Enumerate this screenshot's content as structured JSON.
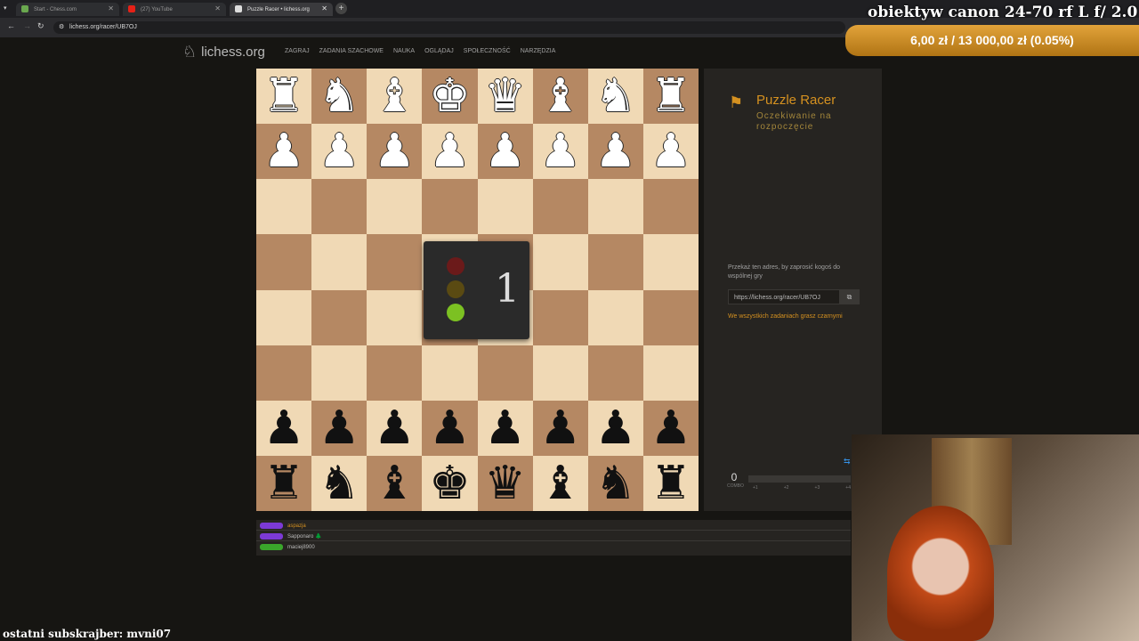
{
  "browser": {
    "tabs": [
      {
        "label": "Start - Chess.com",
        "color": "#6aa84f"
      },
      {
        "label": "(27) YouTube",
        "color": "#e62117"
      },
      {
        "label": "Puzzle Racer • lichess.org",
        "color": "#ffffff"
      }
    ],
    "url": "lichess.org/racer/UB7OJ"
  },
  "overlay": {
    "title": "obiektyw canon 24-70 rf L f/ 2.0",
    "goal": "6,00 zł / 13 000,00 zł (0.05%)",
    "goal_progress": 0.05,
    "last_sub": "ostatni subskrajber: mvni07"
  },
  "site": {
    "logo": "lichess.org",
    "nav": [
      "ZAGRAJ",
      "ZADANIA SZACHOWE",
      "NAUKA",
      "OGLĄDAJ",
      "SPOŁECZNOŚĆ",
      "NARZĘDZIA"
    ]
  },
  "board": {
    "rows": [
      [
        "♜",
        "♞",
        "♝",
        "♚",
        "♛",
        "♝",
        "♞",
        "♜"
      ],
      [
        "♟",
        "♟",
        "♟",
        "♟",
        "♟",
        "♟",
        "♟",
        "♟"
      ],
      [
        "",
        "",
        "",
        "",
        "",
        "",
        "",
        ""
      ],
      [
        "",
        "",
        "",
        "",
        "",
        "",
        "",
        ""
      ],
      [
        "",
        "",
        "",
        "",
        "",
        "",
        "",
        ""
      ],
      [
        "",
        "",
        "",
        "",
        "",
        "",
        "",
        ""
      ],
      [
        "♟",
        "♟",
        "♟",
        "♟",
        "♟",
        "♟",
        "♟",
        "♟"
      ],
      [
        "♜",
        "♞",
        "♝",
        "♚",
        "♛",
        "♝",
        "♞",
        "♜"
      ]
    ],
    "row_colors": [
      "w",
      "w",
      "",
      "",
      "",
      "",
      "b",
      "b"
    ]
  },
  "countdown": {
    "number": "1",
    "lights": [
      "#6b1a1a",
      "#5a4a12",
      "#7cc122"
    ]
  },
  "side": {
    "title": "Puzzle Racer",
    "status": "Oczekiwanie na rozpoczęcie",
    "invite_text": "Przekaż ten adres, by zaprosić kogoś do wspólnej gry",
    "invite_url": "https://lichess.org/racer/UB7OJ",
    "black_note": "We wszystkich zadaniach grasz czarnymi",
    "combo_value": "0",
    "combo_label": "COMBO",
    "combo_marks": [
      "+1",
      "+2",
      "+3",
      "+4"
    ]
  },
  "racers": [
    {
      "name": "aspazja",
      "color": "#7c3ad6",
      "name_color": "#d59120"
    },
    {
      "name": "Sapponaro 🌲",
      "color": "#7c3ad6",
      "name_color": "#bababa"
    },
    {
      "name": "maciej8900",
      "color": "#3aa62b",
      "name_color": "#bababa"
    }
  ]
}
